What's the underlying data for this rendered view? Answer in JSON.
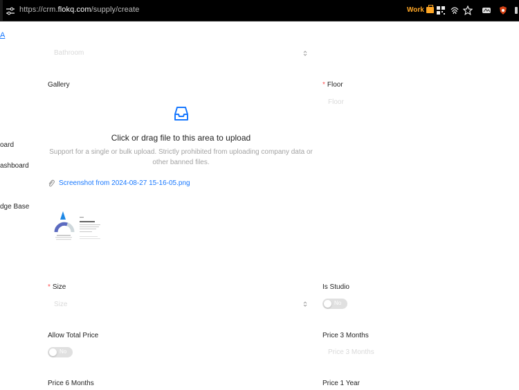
{
  "browser": {
    "url_prefix": "https://crm.",
    "url_host": "flokq.com",
    "url_path": "/supply/create",
    "container_label": "Work"
  },
  "sidebar": {
    "top_link": "A",
    "items": [
      {
        "label": "oard"
      },
      {
        "label": "ashboard"
      },
      {
        "label": "dge Base"
      }
    ]
  },
  "form": {
    "bathroom": {
      "placeholder": "Bathroom"
    },
    "gallery": {
      "label": "Gallery",
      "upload_title": "Click or drag file to this area to upload",
      "upload_hint": "Support for a single or bulk upload. Strictly prohibited from uploading company data or other banned files.",
      "file_name": "Screenshot from 2024-08-27 15-16-05.png"
    },
    "floor": {
      "label": "Floor",
      "placeholder": "Floor",
      "required": "*"
    },
    "size": {
      "label": "Size",
      "placeholder": "Size",
      "required": "*"
    },
    "is_studio": {
      "label": "Is Studio",
      "value": "No"
    },
    "allow_total_price": {
      "label": "Allow Total Price",
      "value": "No"
    },
    "price_3_months": {
      "label": "Price 3 Months",
      "placeholder": "Price 3 Months"
    },
    "price_6_months": {
      "label": "Price 6 Months"
    },
    "price_1_year": {
      "label": "Price 1 Year"
    }
  },
  "colors": {
    "accent": "#1677ff",
    "required": "#ff4d4f",
    "container_badge": "#ffa726"
  }
}
